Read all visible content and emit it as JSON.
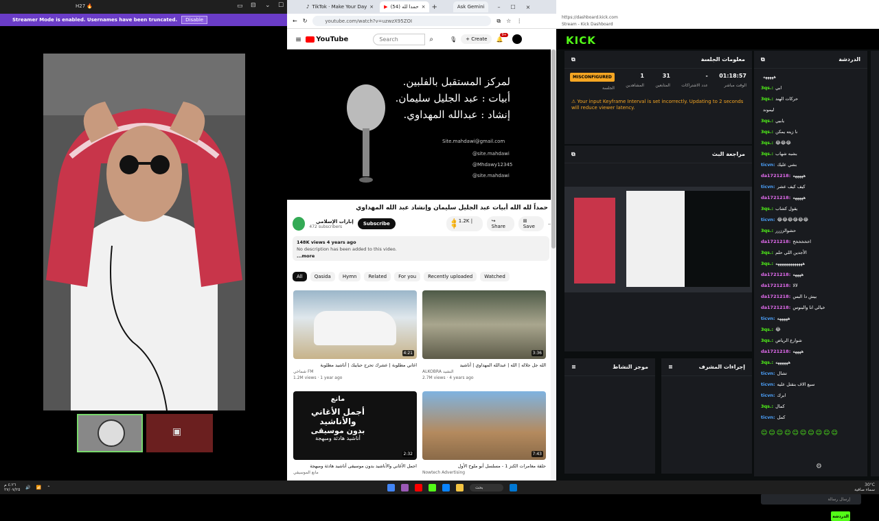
{
  "left": {
    "topbar_time": "H27 🔥",
    "banner_text": "Streamer Mode is enabled. Usernames have been truncated.",
    "banner_button": "Disable"
  },
  "browser": {
    "tabs": [
      "TikTok · Make Your Day",
      "(54) حمدا لله",
      "Ask Gemini"
    ],
    "url": "youtube.com/watch?v=uzwzX95ZOI",
    "search_placeholder": "Search",
    "create_label": "Create",
    "notif_count": "9+",
    "logo": "YouTube",
    "player_lines": [
      "لمركز المستقبل بالفلبين.",
      "أبيات : عبد الجليل سليمان.",
      "إنشاد : عبدالله المهداوي."
    ],
    "player_social": [
      "Site.mahdawi@gmail.com",
      "@site.mahdawi",
      "@Mhdawy12345",
      "@site.mahdawi"
    ],
    "video_title": "حمداً لله الله أبيات عبد الجليل سليمان وإنشاد عبد الله المهداوي",
    "channel_name": "إنارات الإسلامي",
    "subscribers": "472 subscribers",
    "subscribe_label": "Subscribe",
    "likes": "1.2K",
    "share_label": "Share",
    "save_label": "Save",
    "views_line": "148K views  4 years ago",
    "description": "No description has been added to this video.",
    "more_label": "...more",
    "chips": [
      "All",
      "Qasida",
      "Hymn",
      "Related",
      "For you",
      "Recently uploaded",
      "Watched"
    ],
    "videos": [
      {
        "title": "اغاني مطلوبة | عشرك تحرج حبايبك | أناشيد مطلوبة",
        "channel": "شماخي FM",
        "meta": "1.2M views · 1 year ago",
        "duration": "4:21"
      },
      {
        "title": "الله جل جلاله | الله | عبدالله المهداوي | أناشيد",
        "channel": "ALKOBRA النشيد",
        "meta": "2.7M views · 4 years ago",
        "duration": "3:36"
      },
      {
        "title": "اجمل الأغاني والأناشيد بدون موسيقى أناشيد هادئة ومبهجة",
        "channel": "مانع الموسيقي",
        "meta": "",
        "duration": "2:32"
      },
      {
        "title": "حلقة مغامرات الكنز 1 - مسلسل أبو ملوح الأول",
        "channel": "Nowtech Advertising",
        "meta": "",
        "duration": "7:43"
      }
    ],
    "thumb3_text": [
      "مانع",
      "أجمل الأغاني والأناشيد",
      "بدون موسيقى",
      "أناشيد هادئة ومبهجة"
    ]
  },
  "kick": {
    "tab_title": "Stream - Kick Dashboard",
    "url": "https://dashboard.kick.com",
    "logo": "KICK",
    "session_title": "معلومات الجلسة",
    "stats": [
      {
        "v": "01:18:57",
        "l": "الوقت مباشر"
      },
      {
        "v": "-",
        "l": "عدد الاشتراكات"
      },
      {
        "v": "31",
        "l": "المتابعين"
      },
      {
        "v": "1",
        "l": "المشاهدين"
      },
      {
        "v": "MISCONFIGURED",
        "l": "الجلسة"
      }
    ],
    "warning": "Your input Keyframe Interval is set incorrectly. Updating to 2 seconds will reduce viewer latency.",
    "preview_title": "مراجعة البث",
    "activity_title": "موجز النشاط",
    "mod_title": "إجراءات المشرف",
    "chat_title": "الدردشة",
    "chat_placeholder": "إرسال رسالة",
    "chat_button": "الدردشة",
    "messages": [
      {
        "u": "",
        "t": "هههههه",
        "c": "#fff"
      },
      {
        "u": "3qs.:",
        "t": "ابي",
        "c": "#53fc18"
      },
      {
        "u": "3qs.:",
        "t": "حركات الهند",
        "c": "#53fc18"
      },
      {
        "u": "",
        "t": "ليموند",
        "c": "#fff"
      },
      {
        "u": "3qs.:",
        "t": "يابيي",
        "c": "#53fc18"
      },
      {
        "u": "3qs.:",
        "t": "نا زيته يمكن",
        "c": "#53fc18"
      },
      {
        "u": "3qs.:",
        "t": "😂😂😂",
        "c": "#53fc18"
      },
      {
        "u": "3qs.:",
        "t": "بشبه شهاب",
        "c": "#53fc18"
      },
      {
        "u": "ticvn:",
        "t": "بشي عليك",
        "c": "#4da3ff"
      },
      {
        "u": "da1721218:",
        "t": "هههههه",
        "c": "#e46cf0"
      },
      {
        "u": "ticvn:",
        "t": "كيف كيف عشر",
        "c": "#4da3ff"
      },
      {
        "u": "da1721218:",
        "t": "هههههه",
        "c": "#e46cf0"
      },
      {
        "u": "3qs.:",
        "t": "يقول كشاب",
        "c": "#53fc18"
      },
      {
        "u": "ticvn:",
        "t": "😂😂😂😂😂😂",
        "c": "#4da3ff"
      },
      {
        "u": "3qs.:",
        "t": "حشوالززرر",
        "c": "#53fc18"
      },
      {
        "u": "da1721218:",
        "t": "اخخخخخخ",
        "c": "#e46cf0"
      },
      {
        "u": "3qs.:",
        "t": "الأجدين اللي حلم",
        "c": "#53fc18"
      },
      {
        "u": "3qs.:",
        "t": "هههههههههههههه",
        "c": "#53fc18"
      },
      {
        "u": "da1721218:",
        "t": "ههههه",
        "c": "#e46cf0"
      },
      {
        "u": "da1721218:",
        "t": "لالا",
        "c": "#e46cf0"
      },
      {
        "u": "da1721218:",
        "t": "بيش دا البس",
        "c": "#e46cf0"
      },
      {
        "u": "da1721218:",
        "t": "خيالي انا والبنوس",
        "c": "#e46cf0"
      },
      {
        "u": "ticvn:",
        "t": "هههههه",
        "c": "#4da3ff"
      },
      {
        "u": "3qs.:",
        "t": "😂",
        "c": "#53fc18"
      },
      {
        "u": "3qs.:",
        "t": "شوارع الرياض",
        "c": "#53fc18"
      },
      {
        "u": "da1721218:",
        "t": "ههههه",
        "c": "#e46cf0"
      },
      {
        "u": "3qs.:",
        "t": "ههههههه",
        "c": "#53fc18"
      },
      {
        "u": "ticvn:",
        "t": "تشال",
        "c": "#4da3ff"
      },
      {
        "u": "ticvn:",
        "t": "سبع الاف بنقتل عليه",
        "c": "#4da3ff"
      },
      {
        "u": "ticvn:",
        "t": "ابرك",
        "c": "#4da3ff"
      },
      {
        "u": "3qs.:",
        "t": "كمال",
        "c": "#53fc18"
      },
      {
        "u": "ticvn:",
        "t": "كمل",
        "c": "#4da3ff"
      }
    ]
  },
  "taskbar": {
    "time": "٤:٢٦ م",
    "date": "٢٧/٠٧/٢٥",
    "search": "بحث",
    "weather": "30°C",
    "weather_desc": "سماء صافية"
  }
}
